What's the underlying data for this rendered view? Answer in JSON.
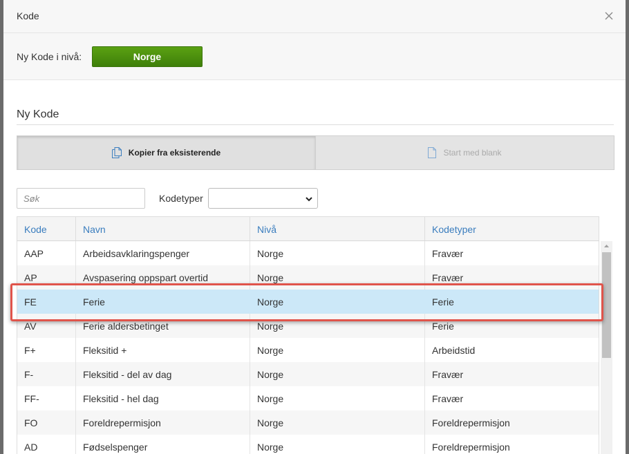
{
  "modal": {
    "title": "Kode"
  },
  "level": {
    "label": "Ny Kode i nivå:",
    "button_label": "Norge"
  },
  "section": {
    "title": "Ny Kode"
  },
  "mode": {
    "copy_label": "Kopier fra eksisterende",
    "blank_label": "Start med blank"
  },
  "filters": {
    "search_placeholder": "Søk",
    "kodetyper_label": "Kodetyper",
    "kodetyper_value": ""
  },
  "table": {
    "headers": {
      "kode": "Kode",
      "navn": "Navn",
      "niva": "Nivå",
      "kodetyper": "Kodetyper"
    },
    "rows": [
      {
        "kode": "AAP",
        "navn": "Arbeidsavklaringspenger",
        "niva": "Norge",
        "kodetyper": "Fravær"
      },
      {
        "kode": "AP",
        "navn": "Avspasering oppspart overtid",
        "niva": "Norge",
        "kodetyper": "Fravær"
      },
      {
        "kode": "FE",
        "navn": "Ferie",
        "niva": "Norge",
        "kodetyper": "Ferie"
      },
      {
        "kode": "AV",
        "navn": "Ferie aldersbetinget",
        "niva": "Norge",
        "kodetyper": "Ferie"
      },
      {
        "kode": "F+",
        "navn": "Fleksitid +",
        "niva": "Norge",
        "kodetyper": "Arbeidstid"
      },
      {
        "kode": "F-",
        "navn": "Fleksitid - del av dag",
        "niva": "Norge",
        "kodetyper": "Fravær"
      },
      {
        "kode": "FF-",
        "navn": "Fleksitid - hel dag",
        "niva": "Norge",
        "kodetyper": "Fravær"
      },
      {
        "kode": "FO",
        "navn": "Foreldrepermisjon",
        "niva": "Norge",
        "kodetyper": "Foreldrepermisjon"
      },
      {
        "kode": "AD",
        "navn": "Fødselspenger",
        "niva": "Norge",
        "kodetyper": "Foreldrepermisjon"
      }
    ],
    "selected_index": 2
  },
  "colors": {
    "accent_green": "#4a9310",
    "header_blue": "#3a7dbe",
    "selected_row": "#cce8f8",
    "highlight_red": "#e0544b"
  },
  "icons": {
    "close": "close-icon",
    "copy": "copy-document-icon",
    "blank": "blank-document-icon",
    "select": "chevron-down-icon"
  }
}
